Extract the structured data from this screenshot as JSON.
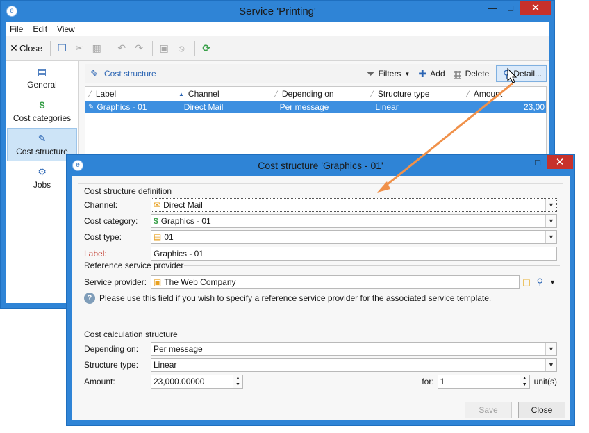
{
  "main_window": {
    "title": "Service 'Printing'",
    "menu": [
      "File",
      "Edit",
      "View"
    ],
    "toolbar": {
      "close_label": "Close"
    },
    "sidebar": [
      {
        "label": "General",
        "icon": "clipboard-icon"
      },
      {
        "label": "Cost categories",
        "icon": "dollar-icon"
      },
      {
        "label": "Cost structure",
        "icon": "cost-structure-icon",
        "active": true
      },
      {
        "label": "Jobs",
        "icon": "gears-icon"
      }
    ],
    "list": {
      "title": "Cost structure",
      "filters_label": "Filters",
      "add_label": "Add",
      "delete_label": "Delete",
      "detail_label": "Detail...",
      "columns": [
        "Label",
        "Channel",
        "Depending on",
        "Structure type",
        "Amount"
      ],
      "rows": [
        {
          "label": "Graphics - 01",
          "channel": "Direct Mail",
          "depending_on": "Per message",
          "structure_type": "Linear",
          "amount": "23,00"
        }
      ]
    }
  },
  "dialog": {
    "title": "Cost structure 'Graphics - 01'",
    "definition": {
      "heading": "Cost structure definition",
      "channel_label": "Channel:",
      "channel_value": "Direct Mail",
      "cost_category_label": "Cost category:",
      "cost_category_value": "Graphics - 01",
      "cost_type_label": "Cost type:",
      "cost_type_value": "01",
      "label_label": "Label:",
      "label_value": "Graphics - 01"
    },
    "reference": {
      "heading": "Reference service provider",
      "provider_label": "Service provider:",
      "provider_value": "The Web Company",
      "help_text": "Please use this field if you wish to specify a reference service provider for the associated service template."
    },
    "calculation": {
      "heading": "Cost calculation structure",
      "depending_on_label": "Depending on:",
      "depending_on_value": "Per message",
      "structure_type_label": "Structure type:",
      "structure_type_value": "Linear",
      "amount_label": "Amount:",
      "amount_value": "23,000.00000",
      "for_label": "for:",
      "for_value": "1",
      "unit_label": "unit(s)"
    },
    "buttons": {
      "save": "Save",
      "close": "Close"
    }
  },
  "colors": {
    "window_frame": "#2f84d6",
    "selection": "#3d8fe0",
    "annotation_arrow": "#f0914a",
    "close_button": "#c7312b"
  }
}
